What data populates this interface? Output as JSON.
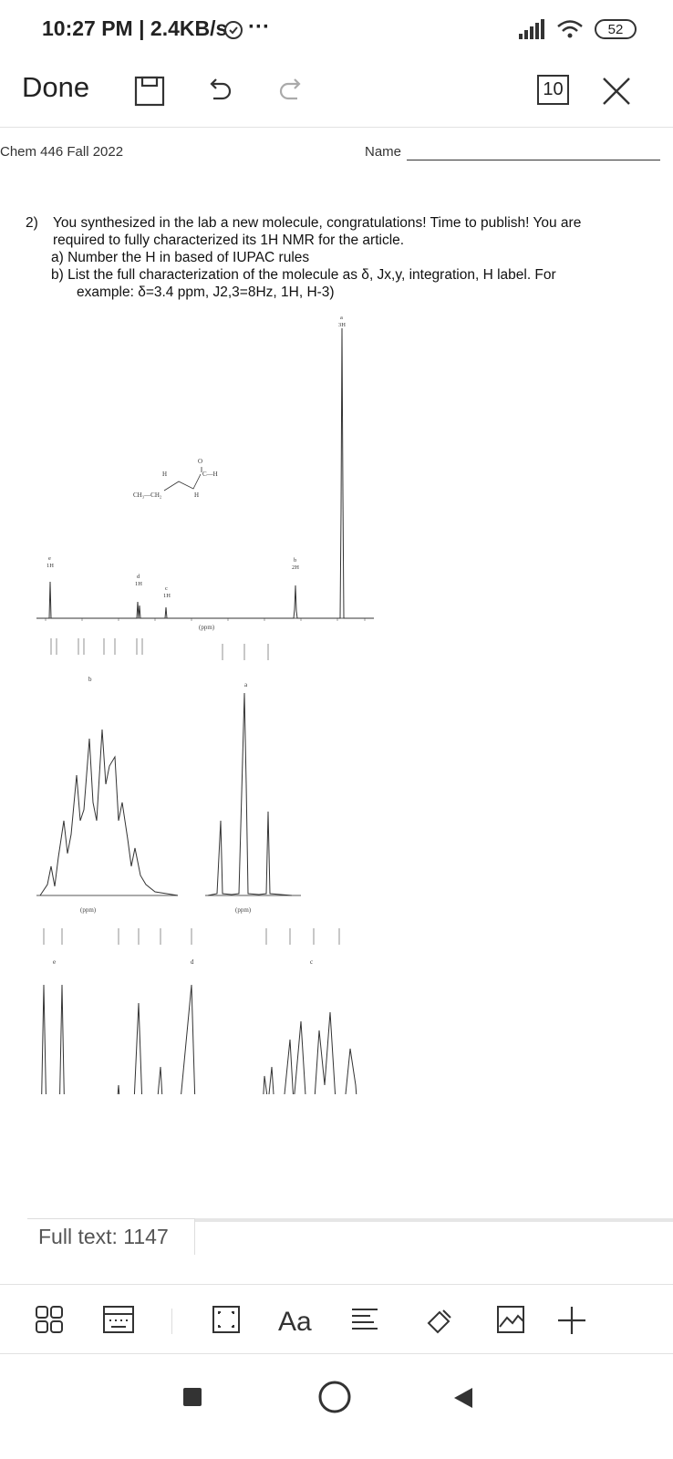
{
  "status": {
    "time": "10:27 PM | 2.4KB/s",
    "dots": "···",
    "battery": "52"
  },
  "toolbar": {
    "done_label": "Done",
    "page_count": "10"
  },
  "document": {
    "course": "Chem 446 Fall 2022",
    "name_label": "Name",
    "question_number": "2)",
    "question_line1": "You synthesized in the lab a new molecule, congratulations! Time to publish! You are",
    "question_line2": "required to fully characterized its 1H NMR for the article.",
    "part_a": "a)  Number the H in based of IUPAC rules",
    "part_b_line1": "b)  List the full characterization of the molecule as δ, Jx,y, integration, H label. For",
    "part_b_line2": "example: δ=3.4 ppm, J2,3=8Hz, 1H, H-3)",
    "spectrum": {
      "ppm_label": "(ppm)",
      "peak_labels": {
        "a": "a",
        "a_int": "3H",
        "b": "b",
        "b_int": "2H",
        "c": "c",
        "c_int": "1H",
        "d": "d",
        "d_int": "1H",
        "e": "e",
        "e_int": "1H"
      },
      "molecule": {
        "ch3ch2": "CH₃—CH₂",
        "h1": "H",
        "h2": "H",
        "o": "O",
        "ch": "C—H"
      }
    }
  },
  "full_text_label": "Full text: 1147",
  "bottom_toolbar": {
    "font_label": "Aa"
  }
}
